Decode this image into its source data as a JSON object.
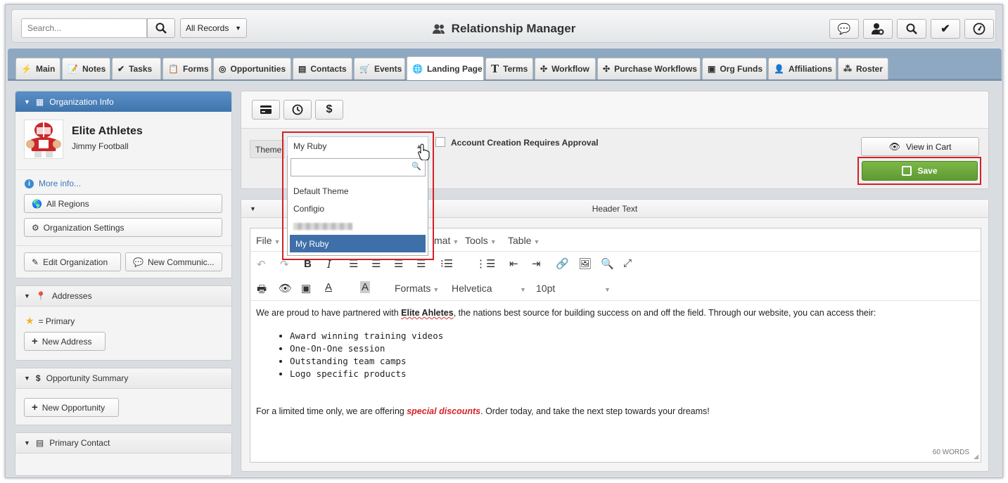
{
  "topbar": {
    "search_placeholder": "Search...",
    "records_filter": "All Records",
    "app_title": "Relationship Manager"
  },
  "tabs": [
    {
      "label": "Main",
      "icon": "bolt-icon"
    },
    {
      "label": "Notes",
      "icon": "notes-icon"
    },
    {
      "label": "Tasks",
      "icon": "check-icon"
    },
    {
      "label": "Forms",
      "icon": "clipboard-icon"
    },
    {
      "label": "Opportunities",
      "icon": "target-icon"
    },
    {
      "label": "Contacts",
      "icon": "id-card-icon"
    },
    {
      "label": "Events",
      "icon": "cart-icon"
    },
    {
      "label": "Landing Page",
      "icon": "globe-icon"
    },
    {
      "label": "Terms",
      "icon": "text-icon"
    },
    {
      "label": "Workflow",
      "icon": "workflow-icon"
    },
    {
      "label": "Purchase Workflows",
      "icon": "workflow-icon"
    },
    {
      "label": "Org Funds",
      "icon": "wallet-icon"
    },
    {
      "label": "Affiliations",
      "icon": "user-icon"
    },
    {
      "label": "Roster",
      "icon": "hierarchy-icon"
    }
  ],
  "org_info": {
    "header": "Organization Info",
    "name": "Elite Athletes",
    "contact": "Jimmy Football",
    "more_info": "More info...",
    "all_regions": "All Regions",
    "org_settings": "Organization Settings",
    "edit_org": "Edit Organization",
    "new_comm": "New Communic..."
  },
  "addresses": {
    "header": "Addresses",
    "primary_legend": "= Primary",
    "new_address": "New Address"
  },
  "opportunity": {
    "header": "Opportunity Summary",
    "new_opportunity": "New Opportunity"
  },
  "primary_contact": {
    "header": "Primary Contact"
  },
  "landing": {
    "theme_label": "Theme",
    "theme_value": "My Ruby",
    "theme_options": [
      "Default Theme",
      "Configio",
      "",
      "My Ruby"
    ],
    "approval_label": "Account Creation Requires Approval",
    "view_in_cart": "View in Cart",
    "save": "Save",
    "header_text": "Header Text"
  },
  "editor": {
    "menus": [
      "File",
      "mat",
      "Tools",
      "Table"
    ],
    "formats": "Formats",
    "font": "Helvetica",
    "size": "10pt",
    "intro_pre": "We are proud to have partnered with ",
    "intro_bold": "Elite Ahletes",
    "intro_post": ", the nations best source for building success on and off the field. Through our website, you can access their:",
    "bullets": [
      "Award winning training videos",
      "One-On-One session",
      "Outstanding team camps",
      "Logo specific products"
    ],
    "closing_pre": "For a limited time only, we are offering ",
    "closing_em": "special discounts",
    "closing_post": ". Order today, and take the next step towards your dreams!",
    "word_count": "60 WORDS"
  },
  "colors": {
    "save_green": "#6aa53c",
    "highlight_red": "#d42026",
    "selected_blue": "#3e6fa8"
  }
}
